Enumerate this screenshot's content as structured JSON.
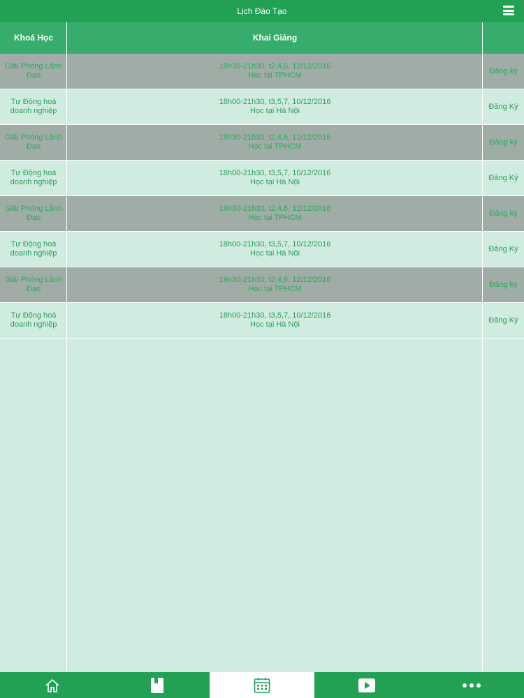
{
  "header": {
    "title": "Lịch Đào Tạo",
    "menu_icon": "menu-icon"
  },
  "table": {
    "columns": [
      "Khoá Học",
      "Khai Giảng",
      ""
    ],
    "rows": [
      {
        "course": "Giải Phóng Lãnh Đạo",
        "schedule": "19h30-21h30, t2,4,6, 12/12/2016",
        "location": "Học tại TPHCM",
        "action": "Đăng ký"
      },
      {
        "course": "Tự Động hoá doanh nghiệp",
        "schedule": "18h00-21h30, t3,5,7, 10/12/2016",
        "location": "Học tại Hà Nội",
        "action": "Đăng Ký"
      },
      {
        "course": "Giải Phóng Lãnh Đạo",
        "schedule": "19h30-21h30, t2,4,6, 12/12/2016",
        "location": "Học tại TPHCM",
        "action": "Đăng ký"
      },
      {
        "course": "Tự Động hoá doanh nghiệp",
        "schedule": "18h00-21h30, t3,5,7, 10/12/2016",
        "location": "Học tại Hà Nội",
        "action": "Đăng Ký"
      },
      {
        "course": "Giải Phóng Lãnh Đạo",
        "schedule": "19h30-21h30, t2,4,6, 12/12/2016",
        "location": "Học tại TPHCM",
        "action": "Đăng ký"
      },
      {
        "course": "Tự Động hoá doanh nghiệp",
        "schedule": "18h00-21h30, t3,5,7, 10/12/2016",
        "location": "Học tại Hà Nội",
        "action": "Đăng Ký"
      },
      {
        "course": "Giải Phóng Lãnh Đạo",
        "schedule": "19h30-21h30, t2,4,6, 12/12/2016",
        "location": "Học tại TPHCM",
        "action": "Đăng ký"
      },
      {
        "course": "Tự Động hoá doanh nghiệp",
        "schedule": "18h00-21h30, t3,5,7, 10/12/2016",
        "location": "Học tại Hà Nội",
        "action": "Đăng Ký"
      }
    ]
  },
  "tabbar": {
    "items": [
      {
        "icon": "home-icon",
        "active": false
      },
      {
        "icon": "book-icon",
        "active": false
      },
      {
        "icon": "calendar-icon",
        "active": true
      },
      {
        "icon": "video-play-icon",
        "active": false
      },
      {
        "icon": "more-icon",
        "active": false
      }
    ]
  },
  "colors": {
    "primary": "#22a155",
    "header_row": "#36ad6d",
    "row_light": "#d0ebdf",
    "row_dark": "#9fada6",
    "text": "#2ea85f"
  }
}
